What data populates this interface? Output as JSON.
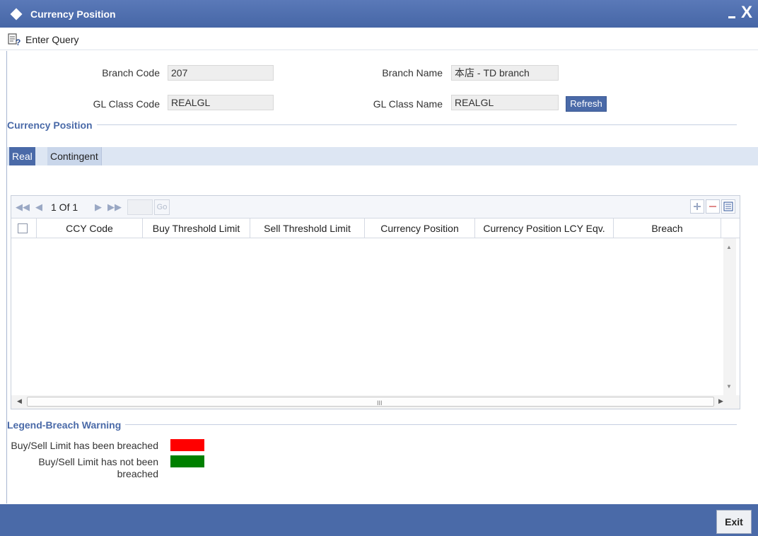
{
  "window": {
    "title": "Currency Position",
    "minimize_icon": "minimize-icon",
    "close_icon": "close-icon",
    "close_glyph": "X"
  },
  "toolbar": {
    "enter_query_label": "Enter Query",
    "enter_query_icon": "query-icon"
  },
  "form": {
    "branch_code_label": "Branch Code",
    "branch_code_value": "207",
    "branch_name_label": "Branch Name",
    "branch_name_value": "本店 - TD branch",
    "gl_class_code_label": "GL Class Code",
    "gl_class_code_value": "REALGL",
    "gl_class_name_label": "GL Class Name",
    "gl_class_name_value": "REALGL",
    "refresh_label": "Refresh"
  },
  "section": {
    "title": "Currency Position"
  },
  "tabs": [
    {
      "label": "Real",
      "active": true
    },
    {
      "label": "Contingent",
      "active": false
    }
  ],
  "grid": {
    "pagination": {
      "text": "1 Of 1",
      "go_label": "Go"
    },
    "columns": [
      "CCY Code",
      "Buy Threshold Limit",
      "Sell Threshold Limit",
      "Currency Position",
      "Currency Position LCY Eqv.",
      "Breach"
    ],
    "rows": [],
    "scroll_grip": "III"
  },
  "legend": {
    "title": "Legend-Breach Warning",
    "breached_label": "Buy/Sell Limit has been breached",
    "not_breached_line1": "Buy/Sell Limit has not been",
    "not_breached_line2": "breached",
    "breached_color": "#ff0000",
    "not_breached_color": "#008000"
  },
  "footer": {
    "exit_label": "Exit"
  },
  "colors": {
    "accent": "#4a6aa8",
    "tab_bar": "#dde6f3"
  }
}
